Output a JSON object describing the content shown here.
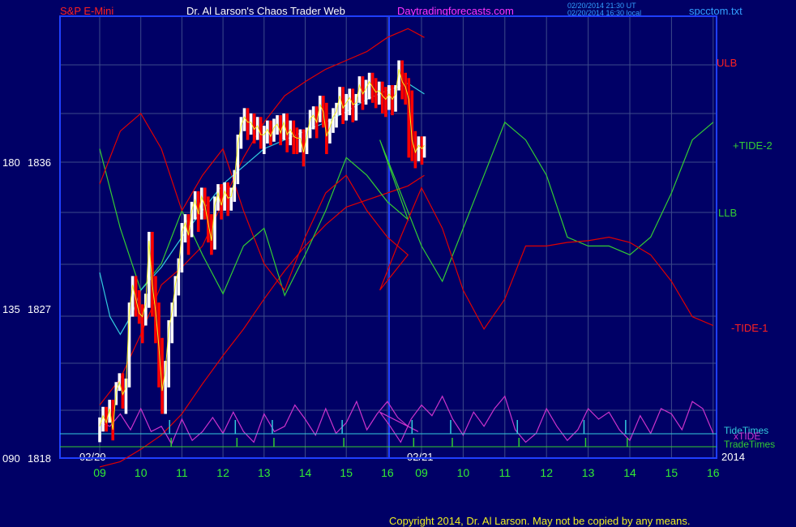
{
  "header": {
    "instrument": "S&P E-Mini",
    "author": "Dr. Al Larson's Chaos Trader Web",
    "site": "Daytradingforecasts.com",
    "stamp_line1": "02/20/2014 21:30 UT",
    "stamp_line2": "02/20/2014 16:30 local",
    "file": "spcctom.txt"
  },
  "footer": {
    "copyright": "Copyright 2014, Dr. Al Larson. May not be copied by any means."
  },
  "colors": {
    "background": "#000066",
    "grid": "#3c4a8a",
    "frame": "#1f3fff",
    "red": "#e00000",
    "green": "#33cc33",
    "cyan": "#33ccdd",
    "magenta": "#cc33cc",
    "yellow": "#f2f220",
    "white": "#ffffff",
    "price_up": "#ffffff",
    "price_down": "#ff0000"
  },
  "chart_data": {
    "type": "line",
    "y_axis": {
      "ticks": [
        {
          "tide": "180",
          "price": "1836"
        },
        {
          "tide": "135",
          "price": "1827"
        },
        {
          "tide": "090",
          "price": "1818"
        }
      ],
      "price_range": [
        1818,
        1843
      ]
    },
    "x_axis": {
      "day_labels": [
        "02/20",
        "02/21"
      ],
      "hour_labels": [
        "09",
        "10",
        "11",
        "12",
        "13",
        "14",
        "15",
        "16",
        "09",
        "10",
        "11",
        "12",
        "13",
        "14",
        "15",
        "16"
      ],
      "year": "2014"
    },
    "series_labels": {
      "ulb": "ULB",
      "tide2": "+TIDE-2",
      "llb": "LLB",
      "tide1": "-TIDE-1",
      "tidetimes": "TideTimes",
      "xtide": "xTIDE",
      "tradetimes": "TradeTimes"
    },
    "series": [
      {
        "name": "ULB",
        "color": "red",
        "x": [
          0,
          0.5,
          1,
          1.5,
          2,
          2.5,
          3,
          3.5,
          4,
          4.5,
          5,
          5.5,
          6,
          6.5,
          7,
          7.5,
          7.9
        ],
        "y": [
          1821,
          1822.5,
          1825,
          1827.8,
          1828.8,
          1830,
          1832.5,
          1835,
          1837,
          1838.5,
          1839.3,
          1840,
          1840.5,
          1841,
          1841.8,
          1842.3,
          1841.8
        ]
      },
      {
        "name": "LLB",
        "color": "red",
        "x": [
          0,
          0.5,
          1,
          1.5,
          2,
          2.5,
          3,
          3.5,
          4,
          4.5,
          5,
          5.5,
          6,
          6.5,
          7,
          7.5,
          7.9
        ],
        "y": [
          1817.5,
          1817.8,
          1818.5,
          1819.3,
          1820.5,
          1822.2,
          1823.8,
          1825.3,
          1827,
          1828.6,
          1830,
          1831.2,
          1832.2,
          1832.6,
          1833,
          1833.4,
          1834
        ]
      },
      {
        "name": "+TIDE-2",
        "color": "green",
        "x": [
          0,
          0.5,
          1,
          1.5,
          2,
          2.5,
          3,
          3.5,
          4,
          4.5,
          5,
          5.5,
          6,
          6.5,
          7,
          7.5,
          8,
          8.5,
          9,
          9.5,
          10,
          10.5,
          11,
          11.5,
          12,
          12.5,
          13,
          13.5,
          14,
          14.5,
          15,
          15.5,
          16
        ],
        "y": [
          1835.5,
          1831,
          1827.5,
          1829,
          1832,
          1829.5,
          1827.3,
          1830,
          1831,
          1827.2,
          1829.5,
          1832,
          1835,
          1834,
          1832.5,
          1831.5,
          1836,
          1833,
          1830,
          1828,
          1831,
          1834,
          1837,
          1836,
          1834,
          1830.5,
          1830,
          1830,
          1829.5,
          1830.5,
          1833,
          1836,
          1837
        ]
      },
      {
        "name": "-TIDE-1",
        "color": "red",
        "x": [
          0,
          0.5,
          1,
          1.5,
          2,
          2.5,
          3,
          3.5,
          4,
          4.5,
          5,
          5.5,
          6,
          6.5,
          7,
          7.5,
          8,
          8.5,
          9,
          9.5,
          10,
          10.5,
          11,
          11.5,
          12,
          12.5,
          13,
          13.5,
          14,
          14.5,
          15,
          15.5,
          16
        ],
        "y": [
          1833.5,
          1836.5,
          1837.5,
          1835.5,
          1832,
          1834,
          1835.5,
          1832,
          1829,
          1827.5,
          1830.5,
          1833,
          1834,
          1832,
          1830.5,
          1829.5,
          1827.5,
          1830.5,
          1833.3,
          1831,
          1827.5,
          1825.3,
          1827,
          1830,
          1830,
          1830.2,
          1830.3,
          1830.5,
          1830.2,
          1829.5,
          1828,
          1826,
          1825.5
        ]
      },
      {
        "name": "Moving average",
        "color": "cyan",
        "x": [
          0,
          0.25,
          0.5,
          0.8,
          1,
          1.5,
          2,
          2.5,
          3,
          3.5,
          4,
          4.5,
          5,
          5.5,
          6,
          6.5,
          7,
          7.5,
          7.9
        ],
        "y": [
          1828.5,
          1826,
          1825,
          1826.2,
          1827.5,
          1828.8,
          1830.5,
          1832,
          1833.5,
          1834.5,
          1835.5,
          1836,
          1836.5,
          1837,
          1837.6,
          1838.3,
          1838.8,
          1839.2,
          1838.6
        ]
      },
      {
        "name": "xTIDE",
        "color": "magenta",
        "x": [
          0,
          0.25,
          0.5,
          0.75,
          1,
          1.25,
          1.5,
          1.75,
          2,
          2.25,
          2.5,
          2.75,
          3,
          3.25,
          3.5,
          3.75,
          4,
          4.25,
          4.5,
          4.75,
          5,
          5.25,
          5.5,
          5.75,
          6,
          6.25,
          6.5,
          6.75,
          7,
          7.25,
          7.5,
          7.75,
          8,
          8.25,
          8.5,
          8.75,
          9,
          9.25,
          9.5,
          9.75,
          10,
          10.25,
          10.5,
          10.75,
          11,
          11.25,
          11.5,
          11.75,
          12,
          12.25,
          12.5,
          12.75,
          13,
          13.25,
          13.5,
          13.75,
          14,
          14.25,
          14.5,
          14.75,
          15,
          15.25,
          15.5,
          15.75,
          16
        ],
        "y": [
          1820,
          1819.8,
          1820.5,
          1819.6,
          1820.8,
          1819.5,
          1819.8,
          1818.8,
          1820.2,
          1819,
          1819.5,
          1820.3,
          1819.4,
          1820.6,
          1819.5,
          1818.9,
          1820.5,
          1819.5,
          1819.8,
          1821,
          1820.2,
          1819.3,
          1820.8,
          1819.4,
          1820,
          1821.2,
          1819.6,
          1820.5,
          1821.2,
          1820.3,
          1819.8,
          1819.5,
          1820.6,
          1819.8,
          1818.9,
          1820.2,
          1821,
          1820.4,
          1821.5,
          1820.2,
          1819.3,
          1820.6,
          1819.8,
          1820.8,
          1821.5,
          1819.6,
          1818.9,
          1819.4,
          1820.8,
          1819.8,
          1819,
          1819.6,
          1820.8,
          1820.2,
          1820.6,
          1819.6,
          1819,
          1820.4,
          1819.4,
          1820.8,
          1820.5,
          1819.6,
          1821.2,
          1820.8,
          1819.4
        ]
      }
    ],
    "price": {
      "color_up": "white",
      "color_down": "red",
      "x": [
        0,
        0.08,
        0.16,
        0.24,
        0.32,
        0.4,
        0.48,
        0.56,
        0.64,
        0.72,
        0.8,
        0.88,
        0.96,
        1.04,
        1.12,
        1.2,
        1.28,
        1.36,
        1.44,
        1.52,
        1.6,
        1.68,
        1.76,
        1.84,
        1.92,
        2,
        2.08,
        2.16,
        2.24,
        2.32,
        2.4,
        2.48,
        2.56,
        2.64,
        2.72,
        2.8,
        2.88,
        2.96,
        3.04,
        3.12,
        3.2,
        3.28,
        3.36,
        3.44,
        3.52,
        3.6,
        3.68,
        3.76,
        3.84,
        3.92,
        4,
        4.08,
        4.16,
        4.24,
        4.32,
        4.4,
        4.48,
        4.56,
        4.64,
        4.72,
        4.8,
        4.88,
        4.96,
        5.04,
        5.12,
        5.2,
        5.28,
        5.36,
        5.44,
        5.52,
        5.6,
        5.68,
        5.76,
        5.84,
        5.92,
        6,
        6.08,
        6.16,
        6.24,
        6.32,
        6.4,
        6.48,
        6.56,
        6.64,
        6.72,
        6.8,
        6.88,
        6.96,
        7.04,
        7.12,
        7.2,
        7.28,
        7.36,
        7.44,
        7.52,
        7.6,
        7.68,
        7.76,
        7.84,
        7.9
      ],
      "y": [
        1820,
        1820.6,
        1820.2,
        1821,
        1819.8,
        1822,
        1822.5,
        1821.8,
        1822.2,
        1826.5,
        1828,
        1827.2,
        1826.4,
        1826.2,
        1827,
        1830.5,
        1828,
        1826.5,
        1824.5,
        1822,
        1823.2,
        1825.5,
        1826.5,
        1828,
        1829,
        1831,
        1831.5,
        1830.8,
        1832.2,
        1832.8,
        1832,
        1833,
        1832.5,
        1831.5,
        1830.5,
        1832.5,
        1833.2,
        1832.5,
        1833.3,
        1832.9,
        1833,
        1834,
        1836,
        1837,
        1837.5,
        1837.2,
        1837.2,
        1836.8,
        1837,
        1836.5,
        1836.5,
        1836.8,
        1836.4,
        1836.9,
        1837.1,
        1836.6,
        1837.2,
        1836.5,
        1836.8,
        1836.4,
        1836.3,
        1836.3,
        1835.5,
        1836.4,
        1837.4,
        1837.6,
        1837.2,
        1838.2,
        1837.8,
        1836.4,
        1836.9,
        1837.5,
        1837.8,
        1838.7,
        1838,
        1838.3,
        1838.6,
        1838.2,
        1838.3,
        1839.3,
        1838.8,
        1839.1,
        1839.5,
        1839.2,
        1838.9,
        1839,
        1838.7,
        1838.5,
        1838.8,
        1838.5,
        1838.8,
        1840.2,
        1839.5,
        1839.2,
        1838.5,
        1836.2,
        1835.5,
        1835.9,
        1835.7,
        1835.9
      ],
      "low": [
        1818.9,
        1819.5,
        1819.5,
        1820,
        1819,
        1821,
        1821.8,
        1820.8,
        1820.5,
        1822,
        1826,
        1826,
        1825.6,
        1824.5,
        1825.5,
        1826.5,
        1826,
        1824.5,
        1822,
        1820.5,
        1820.5,
        1822,
        1824.5,
        1826,
        1827.2,
        1828.5,
        1830.2,
        1829.5,
        1830.5,
        1831.5,
        1830.8,
        1831.5,
        1831.5,
        1830.2,
        1829.5,
        1829.8,
        1832,
        1831.5,
        1832,
        1831.7,
        1832,
        1832.5,
        1833.5,
        1835.5,
        1836.5,
        1836,
        1836.3,
        1835.8,
        1836,
        1835.5,
        1835.2,
        1835.8,
        1835.7,
        1835.9,
        1836.3,
        1835.7,
        1836,
        1835.3,
        1835.7,
        1835.2,
        1835.2,
        1835.3,
        1834.5,
        1835.2,
        1836.1,
        1836.6,
        1836.1,
        1837,
        1836.7,
        1835.2,
        1835.8,
        1836.4,
        1836.7,
        1837.4,
        1836.9,
        1837.1,
        1837.4,
        1837,
        1837.1,
        1838.1,
        1837.7,
        1838,
        1838.3,
        1838.1,
        1837.8,
        1838,
        1837.5,
        1837.3,
        1837.7,
        1837.4,
        1837.6,
        1838.8,
        1838.3,
        1838,
        1835,
        1834.8,
        1834.4,
        1834.8,
        1834.6,
        1835
      ]
    }
  }
}
